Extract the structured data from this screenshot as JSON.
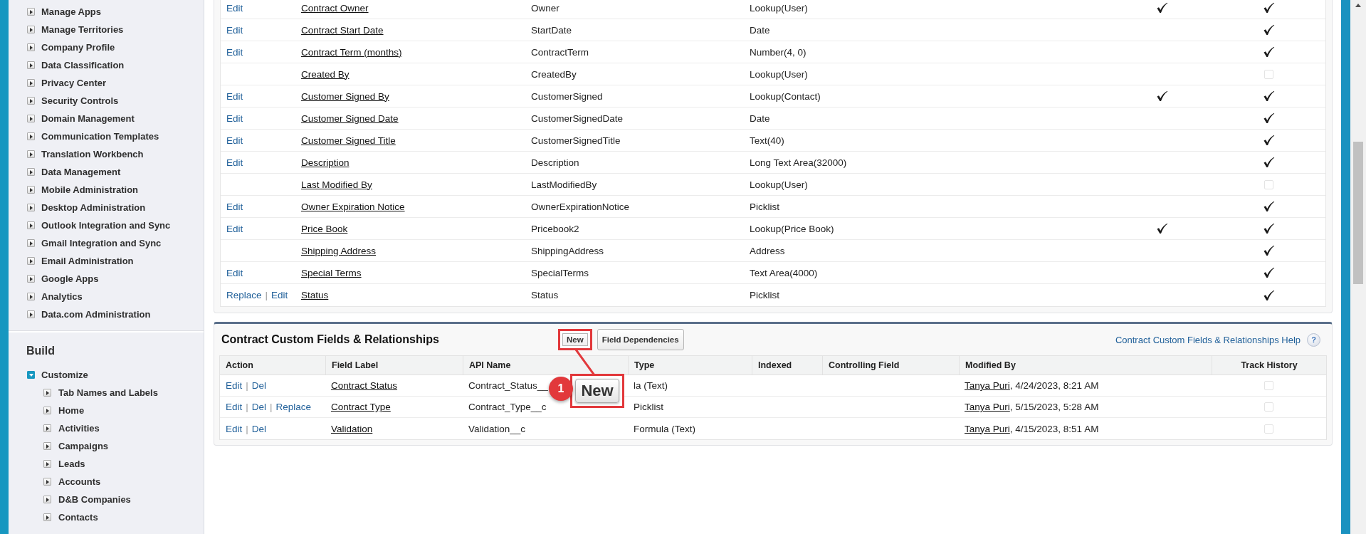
{
  "sidebar": {
    "items": [
      {
        "label": "Manage Apps",
        "expanded": false
      },
      {
        "label": "Manage Territories",
        "expanded": false
      },
      {
        "label": "Company Profile",
        "expanded": false
      },
      {
        "label": "Data Classification",
        "expanded": false
      },
      {
        "label": "Privacy Center",
        "expanded": false
      },
      {
        "label": "Security Controls",
        "expanded": false
      },
      {
        "label": "Domain Management",
        "expanded": false
      },
      {
        "label": "Communication Templates",
        "expanded": false
      },
      {
        "label": "Translation Workbench",
        "expanded": false
      },
      {
        "label": "Data Management",
        "expanded": false
      },
      {
        "label": "Mobile Administration",
        "expanded": false
      },
      {
        "label": "Desktop Administration",
        "expanded": false
      },
      {
        "label": "Outlook Integration and Sync",
        "expanded": false
      },
      {
        "label": "Gmail Integration and Sync",
        "expanded": false
      },
      {
        "label": "Email Administration",
        "expanded": false
      },
      {
        "label": "Google Apps",
        "expanded": false
      },
      {
        "label": "Analytics",
        "expanded": false
      },
      {
        "label": "Data.com Administration",
        "expanded": false
      }
    ],
    "sections": [
      {
        "title": "Build",
        "items": [
          {
            "label": "Customize",
            "expanded": true,
            "children": [
              {
                "label": "Tab Names and Labels",
                "expanded": false
              },
              {
                "label": "Home",
                "expanded": false
              },
              {
                "label": "Activities",
                "expanded": false
              },
              {
                "label": "Campaigns",
                "expanded": false
              },
              {
                "label": "Leads",
                "expanded": false
              },
              {
                "label": "Accounts",
                "expanded": false
              },
              {
                "label": "D&B Companies",
                "expanded": false
              },
              {
                "label": "Contacts",
                "expanded": false
              }
            ]
          }
        ]
      }
    ]
  },
  "standard_fields": {
    "action_separator": "|",
    "rows": [
      {
        "actions": [
          "Edit"
        ],
        "field_label": "Contract Owner",
        "api_name": "Owner",
        "data_type": "Lookup(User)",
        "column_5_checked": true,
        "column_6_checked": true
      },
      {
        "actions": [
          "Edit"
        ],
        "field_label": "Contract Start Date",
        "api_name": "StartDate",
        "data_type": "Date",
        "column_5_checked": false,
        "column_6_checked": true
      },
      {
        "actions": [
          "Edit"
        ],
        "field_label": "Contract Term (months)",
        "api_name": "ContractTerm",
        "data_type": "Number(4, 0)",
        "column_5_checked": false,
        "column_6_checked": true
      },
      {
        "actions": [],
        "field_label": "Created By",
        "api_name": "CreatedBy",
        "data_type": "Lookup(User)",
        "column_5_checked": false,
        "column_6_checked": false
      },
      {
        "actions": [
          "Edit"
        ],
        "field_label": "Customer Signed By",
        "api_name": "CustomerSigned",
        "data_type": "Lookup(Contact)",
        "column_5_checked": true,
        "column_6_checked": true
      },
      {
        "actions": [
          "Edit"
        ],
        "field_label": "Customer Signed Date",
        "api_name": "CustomerSignedDate",
        "data_type": "Date",
        "column_5_checked": false,
        "column_6_checked": true
      },
      {
        "actions": [
          "Edit"
        ],
        "field_label": "Customer Signed Title",
        "api_name": "CustomerSignedTitle",
        "data_type": "Text(40)",
        "column_5_checked": false,
        "column_6_checked": true
      },
      {
        "actions": [
          "Edit"
        ],
        "field_label": "Description",
        "api_name": "Description",
        "data_type": "Long Text Area(32000)",
        "column_5_checked": false,
        "column_6_checked": true
      },
      {
        "actions": [],
        "field_label": "Last Modified By",
        "api_name": "LastModifiedBy",
        "data_type": "Lookup(User)",
        "column_5_checked": false,
        "column_6_checked": false
      },
      {
        "actions": [
          "Edit"
        ],
        "field_label": "Owner Expiration Notice",
        "api_name": "OwnerExpirationNotice",
        "data_type": "Picklist",
        "column_5_checked": false,
        "column_6_checked": true
      },
      {
        "actions": [
          "Edit"
        ],
        "field_label": "Price Book",
        "api_name": "Pricebook2",
        "data_type": "Lookup(Price Book)",
        "column_5_checked": true,
        "column_6_checked": true
      },
      {
        "actions": [],
        "field_label": "Shipping Address",
        "api_name": "ShippingAddress",
        "data_type": "Address",
        "column_5_checked": false,
        "column_6_checked": true
      },
      {
        "actions": [
          "Edit"
        ],
        "field_label": "Special Terms",
        "api_name": "SpecialTerms",
        "data_type": "Text Area(4000)",
        "column_5_checked": false,
        "column_6_checked": true
      },
      {
        "actions": [
          "Replace",
          "Edit"
        ],
        "field_label": "Status",
        "api_name": "Status",
        "data_type": "Picklist",
        "column_5_checked": false,
        "column_6_checked": true
      }
    ]
  },
  "custom_fields": {
    "title": "Contract Custom Fields & Relationships",
    "buttons": [
      {
        "label": "New",
        "highlighted": true
      },
      {
        "label": "Field Dependencies",
        "highlighted": false
      }
    ],
    "help_link": "Contract Custom Fields & Relationships Help",
    "help_icon": "?",
    "action_separator": "|",
    "columns": [
      "Action",
      "Field Label",
      "API Name",
      "Type",
      "Indexed",
      "Controlling Field",
      "Modified By",
      "Track History"
    ],
    "rows": [
      {
        "actions": [
          "Edit",
          "Del"
        ],
        "field_label": "Contract Status",
        "api_name": "Contract_Status__",
        "data_type": "la (Text)",
        "modified_by": "Tanya Puri",
        "modified_at": ", 4/24/2023, 8:21 AM",
        "track_history": false
      },
      {
        "actions": [
          "Edit",
          "Del",
          "Replace"
        ],
        "field_label": "Contract Type",
        "api_name": "Contract_Type__c",
        "data_type": "Picklist",
        "modified_by": "Tanya Puri",
        "modified_at": ", 5/15/2023, 5:28 AM",
        "track_history": false
      },
      {
        "actions": [
          "Edit",
          "Del"
        ],
        "field_label": "Validation",
        "api_name": "Validation__c",
        "data_type": "Formula (Text)",
        "modified_by": "Tanya Puri",
        "modified_at": ", 4/15/2023, 8:51 AM",
        "track_history": false
      }
    ]
  },
  "annotation": {
    "step": "1",
    "label": "New"
  }
}
